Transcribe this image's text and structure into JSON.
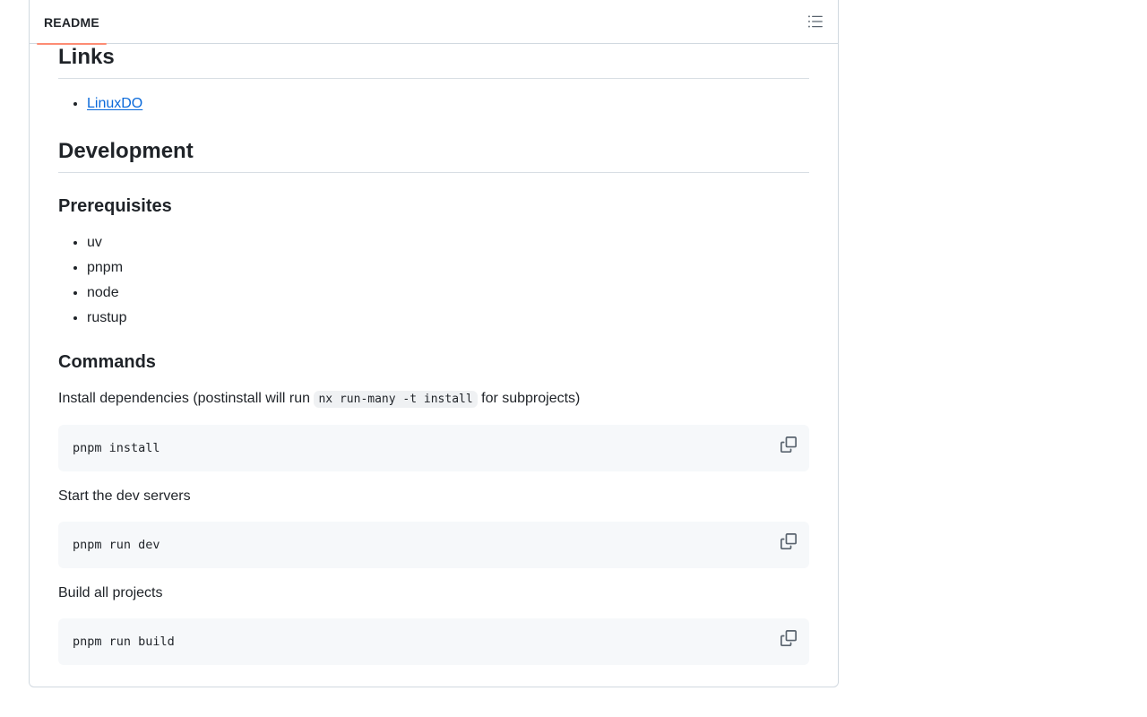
{
  "header": {
    "tab_label": "README",
    "outline_icon": "list-unordered-icon"
  },
  "readme": {
    "links_heading": "Links",
    "links": [
      {
        "label": "LinuxDO"
      }
    ],
    "development_heading": "Development",
    "prerequisites_heading": "Prerequisites",
    "prerequisites": [
      "uv",
      "pnpm",
      "node",
      "rustup"
    ],
    "commands_heading": "Commands",
    "install_text_before": "Install dependencies (postinstall will run ",
    "install_inline_code": "nx run-many -t install",
    "install_text_after": " for subprojects)",
    "install_command": "pnpm install",
    "dev_text": "Start the dev servers",
    "dev_command": "pnpm run dev",
    "build_text": "Build all projects",
    "build_command": "pnpm run build",
    "copy_icon": "copy-icon"
  },
  "colors": {
    "tab_underline": "#fd8c73",
    "link": "#0969da",
    "code_bg": "#f6f8fa",
    "border": "#d1d9e0"
  }
}
